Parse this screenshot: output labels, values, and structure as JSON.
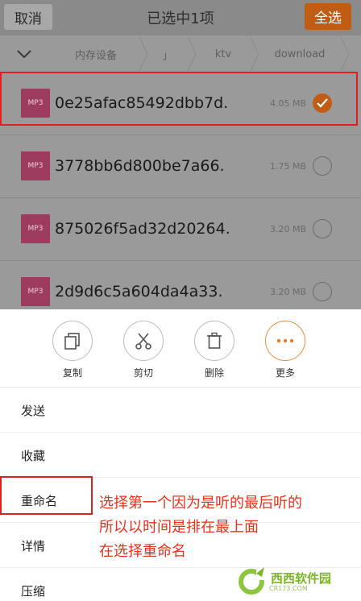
{
  "header": {
    "cancel_label": "取消",
    "title": "已选中1项",
    "select_all_label": "全选"
  },
  "breadcrumb": {
    "items": [
      "内存设备",
      "」",
      "ktv",
      "download"
    ]
  },
  "files": [
    {
      "type": "MP3",
      "name": "0e25afac85492dbb7d.",
      "size": "4.05 MB",
      "selected": true
    },
    {
      "type": "MP3",
      "name": "3778bb6d800be7a66.",
      "size": "1.75 MB",
      "selected": false
    },
    {
      "type": "MP3",
      "name": "875026f5ad32d20264.",
      "size": "3.20 MB",
      "selected": false
    },
    {
      "type": "MP3",
      "name": "2d9d6c5a604da4a33.",
      "size": "3.20 MB",
      "selected": false
    }
  ],
  "actions": [
    {
      "label": "复制",
      "icon": "copy-icon"
    },
    {
      "label": "剪切",
      "icon": "scissors-icon"
    },
    {
      "label": "删除",
      "icon": "trash-icon"
    },
    {
      "label": "更多",
      "icon": "more-icon"
    }
  ],
  "menu": [
    "发送",
    "收藏",
    "重命名",
    "详情",
    "压缩"
  ],
  "annotation": {
    "line1": "选择第一个因为是听的最后听的",
    "line2": "所以以时间是排在最上面",
    "line3": "在选择重命名"
  },
  "watermark": {
    "brand": "西西软件园",
    "sub": "CR173.COM"
  },
  "colors": {
    "accent": "#c05c14",
    "annotation": "#e8321e",
    "mp3_badge": "#9e3c60"
  }
}
